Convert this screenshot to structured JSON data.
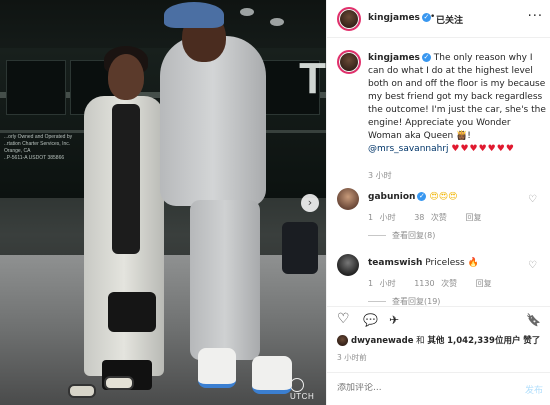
{
  "photo": {
    "watermark": "UTCH",
    "carousel_next": "›",
    "bus_text": "...orly Owned and Operated by\n..rtation Charter Services, Inc.\nOrange, CA\n..P-5611-A   USDOT 385866",
    "bus_letter": "T"
  },
  "header": {
    "username": "kingjames",
    "verified": "✓",
    "separator": "•",
    "follow_status": "已关注",
    "more": "···"
  },
  "caption": {
    "username": "kingjames",
    "verified": "✓",
    "text": "The only reason why I can do what I do at the highest level both on and off the floor is my because my best friend got my back regardless the outcome! I'm just the car, she's the engine! Appreciate you Wonder Woman aka Queen 👸🏾!",
    "mention": "@mrs_savannahrj",
    "hearts": "♥♥♥♥♥♥♥",
    "time": "3 小时"
  },
  "comments": [
    {
      "username": "gabunion",
      "verified": "✓",
      "text": "😍😍😍",
      "time": "1 小时",
      "likes": "38 次赞",
      "reply": "回复",
      "view_replies": "查看回复(8)"
    },
    {
      "username": "teamswish",
      "verified": "",
      "text": "Priceless 🔥",
      "time": "1 小时",
      "likes": "1130 次赞",
      "reply": "回复",
      "view_replies": "查看回复(19)"
    }
  ],
  "actions": {
    "like_icon": "♡",
    "comment_icon": "💬",
    "share_icon": "✈",
    "save_icon": "🔖"
  },
  "likes": {
    "username": "dwyanewade",
    "and": "和",
    "others": "其他",
    "count": "1,042,339",
    "suffix": "位用户",
    "liked": "赞了"
  },
  "post_time": "3 小时前",
  "comment_box": {
    "placeholder": "添加评论...",
    "post_label": "发布"
  }
}
